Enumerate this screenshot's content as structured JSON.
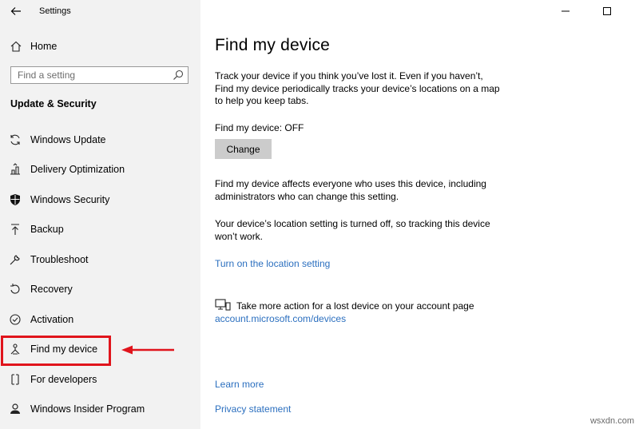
{
  "window": {
    "title": "Settings"
  },
  "sidebar": {
    "home_label": "Home",
    "search_placeholder": "Find a setting",
    "section_title": "Update & Security",
    "items": [
      {
        "label": "Windows Update",
        "icon": "sync-icon"
      },
      {
        "label": "Delivery Optimization",
        "icon": "delivery-optimization-icon"
      },
      {
        "label": "Windows Security",
        "icon": "shield-icon"
      },
      {
        "label": "Backup",
        "icon": "backup-arrow-icon"
      },
      {
        "label": "Troubleshoot",
        "icon": "wrench-icon"
      },
      {
        "label": "Recovery",
        "icon": "recovery-icon"
      },
      {
        "label": "Activation",
        "icon": "activation-check-icon"
      },
      {
        "label": "Find my device",
        "icon": "find-device-icon",
        "selected": true
      },
      {
        "label": "For developers",
        "icon": "developer-icon"
      },
      {
        "label": "Windows Insider Program",
        "icon": "insider-icon"
      }
    ]
  },
  "main": {
    "title": "Find my device",
    "intro": "Track your device if you think you’ve lost it. Even if you haven’t, Find my device periodically tracks your device’s locations on a map to help you keep tabs.",
    "status": "Find my device: OFF",
    "change_label": "Change",
    "affects": "Find my device affects everyone who uses this device, including administrators who can change this setting.",
    "location_off": "Your device’s location setting is turned off, so tracking this device won’t work.",
    "location_link": "Turn on the location setting",
    "more_action": "Take more action for a lost device on your account page",
    "account_link": "account.microsoft.com/devices",
    "learn_more": "Learn more",
    "privacy": "Privacy statement"
  },
  "watermark": "wsxdn.com",
  "colors": {
    "link": "#2b6fbf",
    "highlight": "#e0141c",
    "sidebar_bg": "#f2f2f2"
  }
}
